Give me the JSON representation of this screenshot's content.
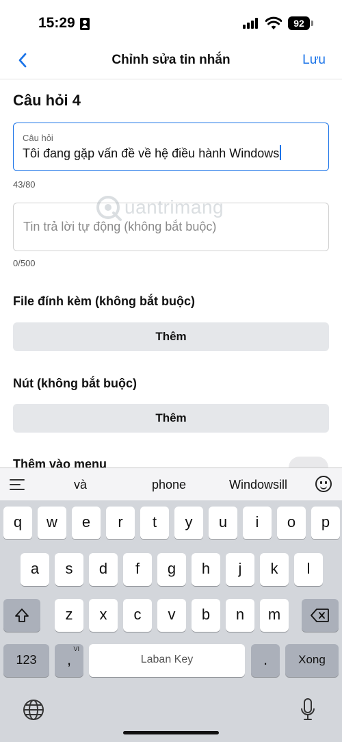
{
  "status_bar": {
    "time": "15:29",
    "battery": "92"
  },
  "nav": {
    "title": "Chỉnh sửa tin nhắn",
    "save_label": "Lưu"
  },
  "form": {
    "section_title": "Câu hỏi 4",
    "question": {
      "label": "Câu hỏi",
      "value": "Tôi đang gặp vấn đề về hệ điều hành Windows",
      "counter": "43/80"
    },
    "auto_reply": {
      "placeholder": "Tin trả lời tự động (không bắt buộc)",
      "counter": "0/500"
    },
    "attachment": {
      "heading": "File đính kèm (không bắt buộc)",
      "button_label": "Thêm"
    },
    "buttons": {
      "heading": "Nút (không bắt buộc)",
      "button_label": "Thêm"
    },
    "menu": {
      "label": "Thêm vào menu",
      "enabled": false
    }
  },
  "watermark": {
    "text": "uantrimang"
  },
  "keyboard": {
    "suggestions": [
      "và",
      "phone",
      "Windowsill"
    ],
    "row1": [
      "q",
      "w",
      "e",
      "r",
      "t",
      "y",
      "u",
      "i",
      "o",
      "p"
    ],
    "row2": [
      "a",
      "s",
      "d",
      "f",
      "g",
      "h",
      "j",
      "k",
      "l"
    ],
    "row3": [
      "z",
      "x",
      "c",
      "v",
      "b",
      "n",
      "m"
    ],
    "numbers_label": "123",
    "comma_key": ",",
    "comma_superscript": "VI",
    "space_label": "Laban Key",
    "period_key": ".",
    "done_label": "Xong",
    "icons": {
      "shift": "shift-icon",
      "backspace": "backspace-icon",
      "globe": "globe-icon",
      "mic": "microphone-icon",
      "menu": "menu-icon",
      "emoji": "emoji-icon"
    }
  },
  "colors": {
    "accent": "#1a73e8",
    "key_dark": "#abb0ba",
    "keyboard_bg": "#d3d6db",
    "button_bg": "#e5e7ea"
  }
}
